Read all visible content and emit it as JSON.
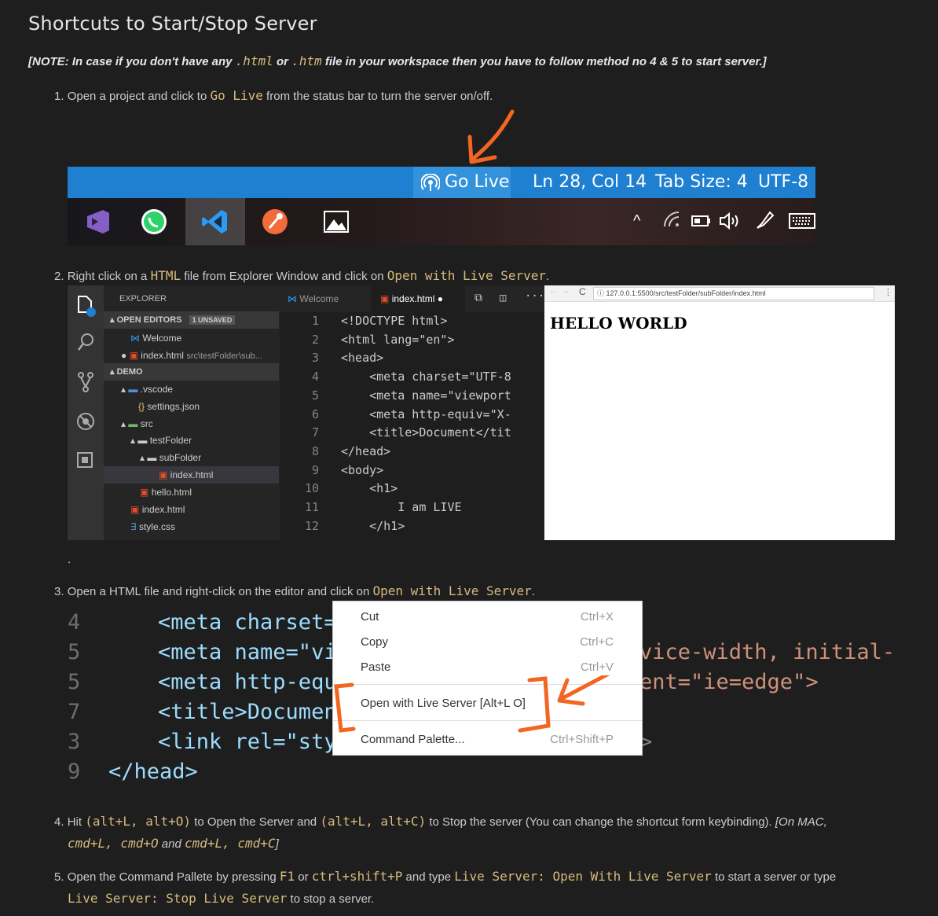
{
  "heading": "Shortcuts to Start/Stop Server",
  "note": {
    "pre": "[NOTE: In case if you don't have any ",
    "code1": ".html",
    "mid": " or ",
    "code2": ".htm",
    "post": " file in your workspace then you have to follow method no 4 & 5 to start server.]"
  },
  "step1": {
    "num": "1.",
    "pre": "Open a project and click to ",
    "code": "Go Live",
    "post": " from the status bar to turn the server on/off."
  },
  "statusbar": {
    "golive": "Go Live",
    "ln": "Ln 28, Col 14",
    "tab": "Tab Size: 4",
    "enc": "UTF-8"
  },
  "step2": {
    "num": "2.",
    "pre": "Right click on a ",
    "code1": "HTML",
    "mid": " file from Explorer Window and click on ",
    "code2": "Open with Live Server",
    "post": "."
  },
  "explorer": {
    "title": "EXPLORER",
    "open_editors": "OPEN EDITORS",
    "unsaved": "1 UNSAVED",
    "welcome": "Welcome",
    "index_open": "index.html",
    "index_path": "src\\testFolder\\sub...",
    "demo": "DEMO",
    "vscode": ".vscode",
    "settings": "settings.json",
    "src": "src",
    "testFolder": "testFolder",
    "subFolder": "subFolder",
    "index_sub": "index.html",
    "hello": "hello.html",
    "index_root": "index.html",
    "style": "style.css"
  },
  "editor_tabs": {
    "welcome": "Welcome",
    "index": "index.html"
  },
  "code_lines": [
    {
      "n": "1",
      "t": "<!DOCTYPE html>"
    },
    {
      "n": "2",
      "t": "<html lang=\"en\">"
    },
    {
      "n": "3",
      "t": "<head>"
    },
    {
      "n": "4",
      "t": "    <meta charset=\"UTF-8"
    },
    {
      "n": "5",
      "t": "    <meta name=\"viewport"
    },
    {
      "n": "6",
      "t": "    <meta http-equiv=\"X-"
    },
    {
      "n": "7",
      "t": "    <title>Document</tit"
    },
    {
      "n": "8",
      "t": "</head>"
    },
    {
      "n": "9",
      "t": "<body>"
    },
    {
      "n": "10",
      "t": "    <h1>"
    },
    {
      "n": "11",
      "t": "        I am LIVE"
    },
    {
      "n": "12",
      "t": "    </h1>"
    }
  ],
  "browser": {
    "url": "127.0.0.1:5500/src/testFolder/subFolder/index.html",
    "body": "HELLO WORLD"
  },
  "dot": ".",
  "step3": {
    "num": "3.",
    "pre": "Open a HTML file and right-click on the editor and click on ",
    "code": "Open with Live Server",
    "post": "."
  },
  "big_code": [
    {
      "n": "4",
      "t": "<meta charset="
    },
    {
      "n": "5",
      "t": "<meta name=\"vi"
    },
    {
      "n": "5",
      "t": "<meta http-equ"
    },
    {
      "n": "7",
      "t": "<title>Documen"
    },
    {
      "n": "3",
      "t": "<link rel=\"sty"
    },
    {
      "n": "9",
      "t": "</head>"
    }
  ],
  "big_code_right": {
    "line2": "vice-width, initial-s",
    "line3": "ent=\"ie=edge\">",
    "line5": ">"
  },
  "context_menu": [
    {
      "label": "Cut",
      "kb": "Ctrl+X"
    },
    {
      "label": "Copy",
      "kb": "Ctrl+C"
    },
    {
      "label": "Paste",
      "kb": "Ctrl+V"
    },
    {
      "label": "Open with Live Server [Alt+L O]",
      "kb": ""
    },
    {
      "label": "Command Palette...",
      "kb": "Ctrl+Shift+P"
    }
  ],
  "step4": {
    "num": "4.",
    "a": "Hit ",
    "c1": "(alt+L, alt+O)",
    "b": " to Open the Server and ",
    "c2": "(alt+L, alt+C)",
    "c": " to Stop the server (You can change the shortcut form keybinding). ",
    "d": "[On MAC,",
    "c3": "cmd+L, cmd+O",
    "e": " and ",
    "c4": "cmd+L, cmd+C",
    "f": "]"
  },
  "step5": {
    "num": "5.",
    "a": "Open the Command Pallete by pressing ",
    "c1": "F1",
    "b": " or ",
    "c2": "ctrl+shift+P",
    "c": " and type ",
    "c3": "Live Server: Open With Live Server",
    "d": " to start a server or type",
    "c4": "Live Server: Stop Live Server",
    "e": " to stop a server."
  },
  "colors": {
    "accent": "#d7ba7d",
    "statusbar": "#1f7fd0",
    "arrow": "#f26522"
  }
}
